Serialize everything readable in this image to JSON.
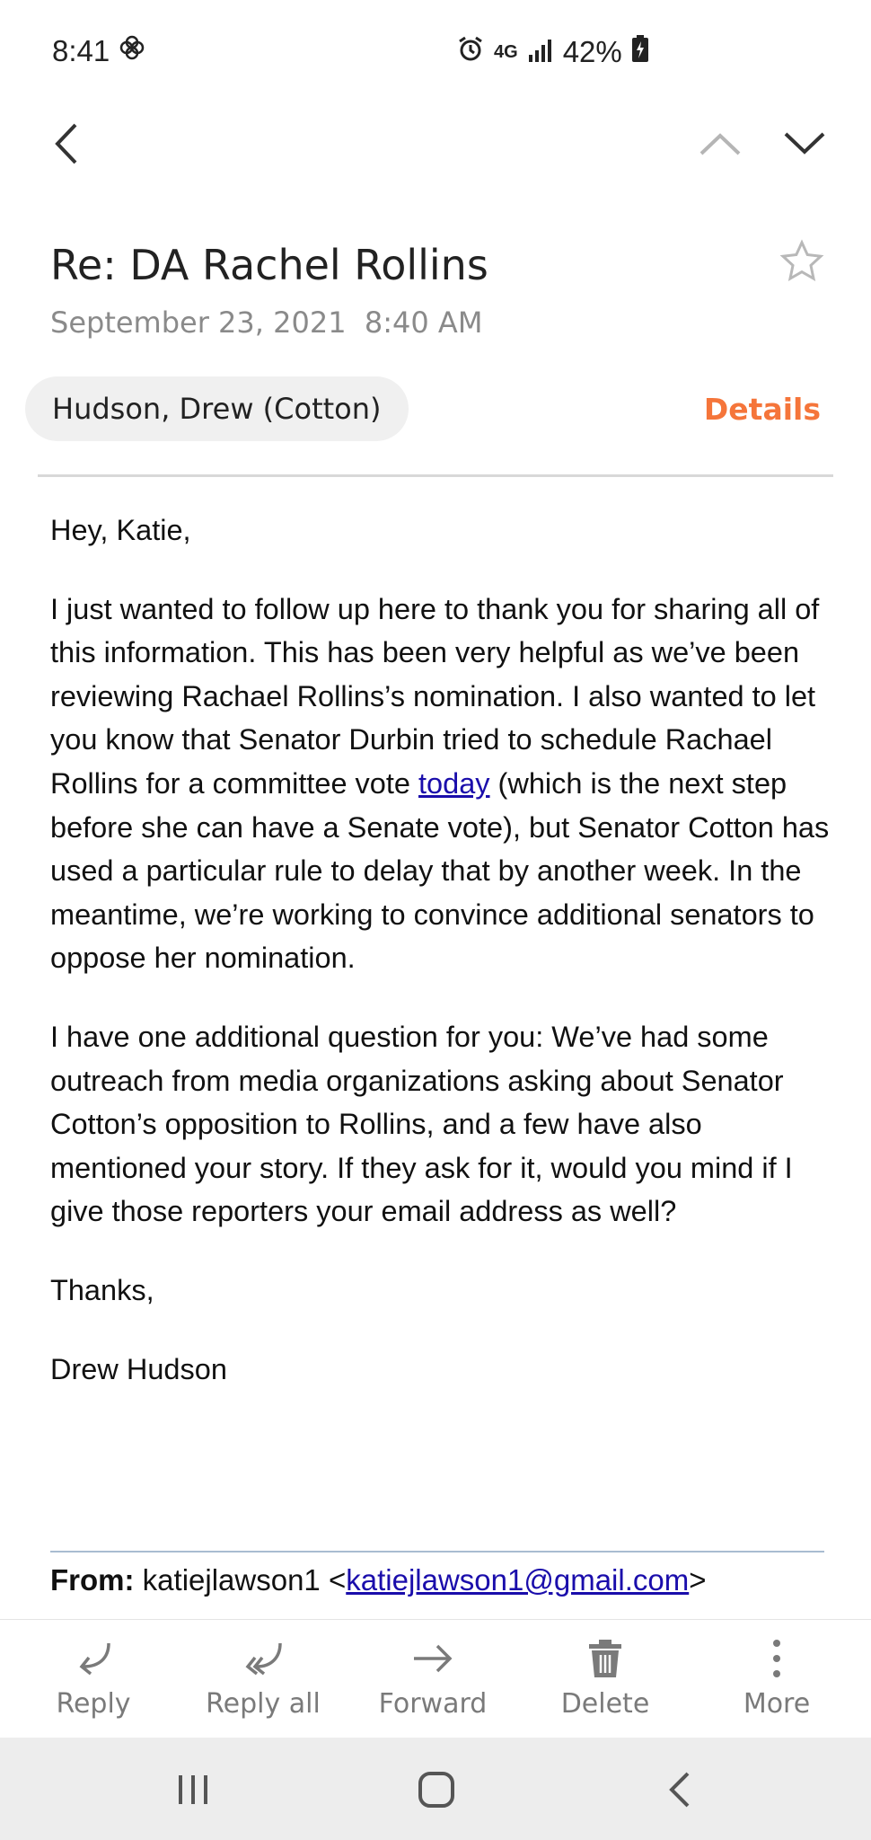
{
  "status_bar": {
    "time": "8:41",
    "network": "4G",
    "battery": "42%"
  },
  "email": {
    "subject": "Re: DA Rachel Rollins",
    "date": "September 23, 2021",
    "time": "8:40 AM",
    "sender": "Hudson, Drew (Cotton)",
    "details_label": "Details",
    "greeting": "Hey, Katie,",
    "para1_before_link": "I just wanted to follow up here to thank you for sharing all of this information. This has been very helpful as we’ve been reviewing Rachael Rollins’s nomination. I also wanted to let you know that Senator Durbin tried to schedule Rachael Rollins for a committee vote ",
    "para1_link": "today",
    "para1_after_link": " (which is the next step before she can have a Senate vote), but Senator Cotton has used a particular rule to delay that by another week. In the meantime, we’re working to convince additional senators to oppose her nomination.",
    "para2": "I have one additional question for you: We’ve had some outreach from media organizations asking about Senator Cotton’s opposition to Rollins, and a few have also mentioned your story. If they ask for it, would you mind if I give those reporters your email address as well?",
    "closing": "Thanks,",
    "signature": "Drew Hudson",
    "from_label": "From:",
    "from_name": "katiejlawson1",
    "from_email": "katiejlawson1@gmail.com"
  },
  "actions": [
    {
      "label": "Reply",
      "icon": "reply-icon"
    },
    {
      "label": "Reply all",
      "icon": "reply-all-icon"
    },
    {
      "label": "Forward",
      "icon": "forward-icon"
    },
    {
      "label": "Delete",
      "icon": "trash-icon"
    },
    {
      "label": "More",
      "icon": "more-vertical-icon"
    }
  ],
  "colors": {
    "accent": "#f5753a",
    "link": "#1a0dab",
    "muted": "#8a8a8a"
  }
}
